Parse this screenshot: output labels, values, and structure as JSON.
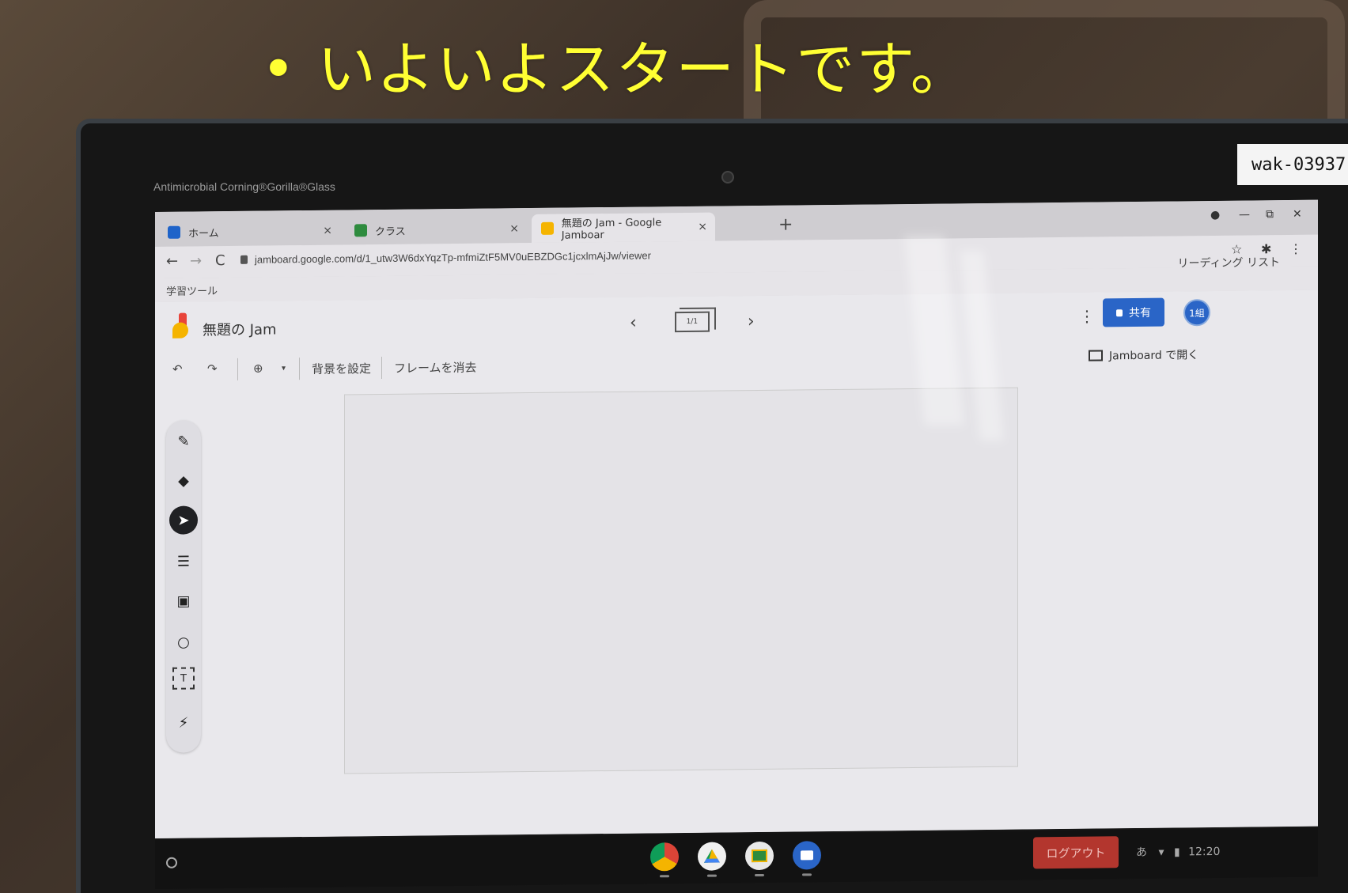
{
  "slide": {
    "headline": "• いよいよスタートです。"
  },
  "device": {
    "bezel_brand": "Antimicrobial Corning®Gorilla®Glass",
    "asset_tag": "wak-03937"
  },
  "browser": {
    "tabs": [
      {
        "label": "ホーム",
        "icon": "classroom-home-icon",
        "close": "×"
      },
      {
        "label": "クラス",
        "icon": "classroom-class-icon",
        "close": "×"
      },
      {
        "label": "無題の Jam - Google Jamboar",
        "icon": "jamboard-icon",
        "close": "×"
      }
    ],
    "new_tab": "+",
    "window_controls": [
      "●",
      "—",
      "⧉",
      "✕"
    ],
    "url": "jamboard.google.com/d/1_utw3W6dxYqzTp-mfmiZtF5MV0uEBZDGc1jcxlmAjJw/viewer",
    "bookmark": "学習ツール",
    "reading_list": "リーディング リスト",
    "nav": {
      "back": "←",
      "forward": "→",
      "reload": "C"
    },
    "right_icons": {
      "star": "☆",
      "extensions": "✱",
      "menu": "⋮"
    }
  },
  "jamboard": {
    "title": "無題の Jam",
    "frame_indicator": "1/1",
    "prev": "‹",
    "next": "›",
    "menu": "⋮",
    "share_label": "共有",
    "account": "1組",
    "toolbar": {
      "undo": "↶",
      "redo": "↷",
      "zoom": "⊕",
      "zoom_caret": "▾",
      "set_background": "背景を設定",
      "clear_frame": "フレームを消去"
    },
    "open_in_jamboard": "Jamboard で開く",
    "tools": [
      {
        "name": "pen",
        "glyph": "✎"
      },
      {
        "name": "eraser",
        "glyph": "◆"
      },
      {
        "name": "select",
        "glyph": "➤"
      },
      {
        "name": "sticky-note",
        "glyph": "☰"
      },
      {
        "name": "image",
        "glyph": "▣"
      },
      {
        "name": "shape",
        "glyph": "○"
      },
      {
        "name": "text-box",
        "glyph": "T"
      },
      {
        "name": "laser",
        "glyph": "⚡"
      }
    ]
  },
  "shelf": {
    "logout_label": "ログアウト",
    "ime": "あ",
    "wifi": "▾",
    "battery": "▮",
    "time": "12:20"
  },
  "colors": {
    "headline": "#ffff33",
    "share_button": "#2a65c7",
    "logout_button": "#b3362e"
  }
}
